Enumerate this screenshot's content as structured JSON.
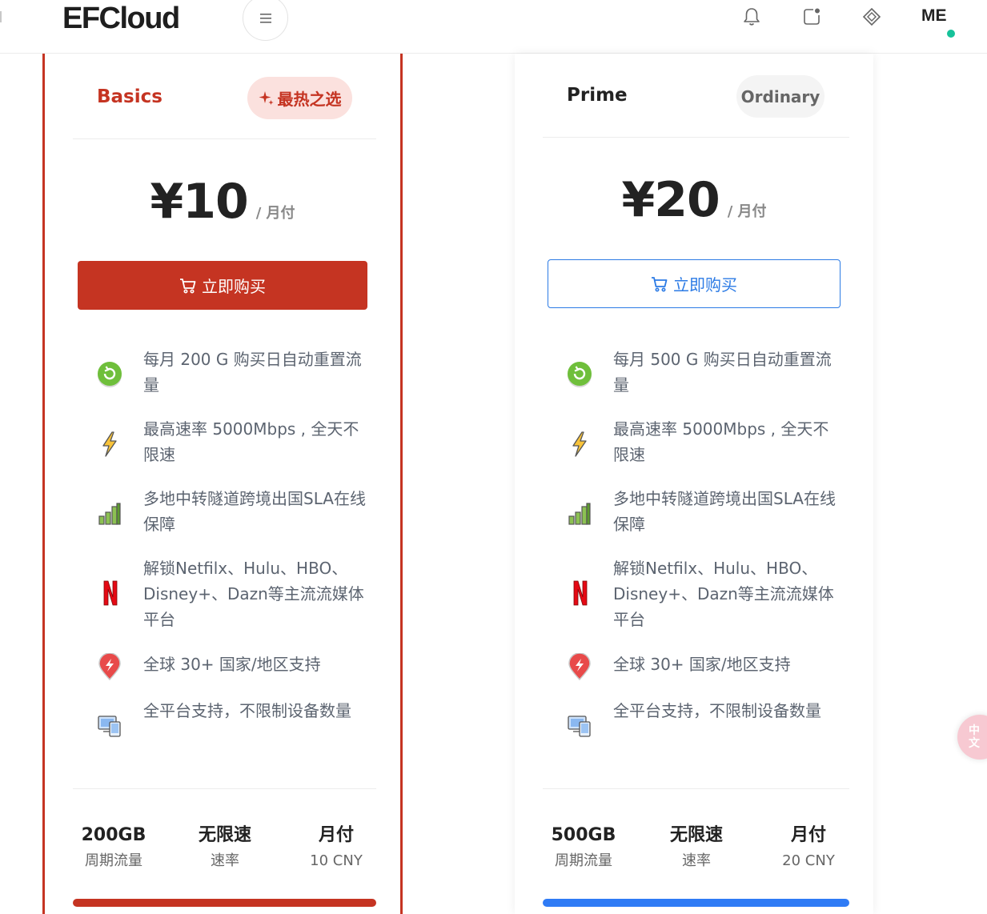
{
  "header": {
    "logo": "EFCloud",
    "user": "ME",
    "icons": [
      "menu-icon",
      "bell-icon",
      "notification-icon",
      "diamond-icon"
    ]
  },
  "colors": {
    "accent_red": "#c53422",
    "accent_blue": "#2f7bf5",
    "online": "#16c29a"
  },
  "plans": [
    {
      "name": "Basics",
      "badge": "最热之选",
      "price": "¥10",
      "period": "/ 月付",
      "buy_label": "立即购买",
      "features": [
        {
          "icon": "refresh-icon",
          "text": "每月 200 G 购买日自动重置流量"
        },
        {
          "icon": "lightning-icon",
          "text": "最高速率 5000Mbps , 全天不限速"
        },
        {
          "icon": "bar-chart-icon",
          "text": "多地中转隧道跨境出国SLA在线保障"
        },
        {
          "icon": "netflix-icon",
          "text": "解锁Netfilx、Hulu、HBO、Disney+、Dazn等主流流媒体平台"
        },
        {
          "icon": "location-pin-icon",
          "text": "全球 30+ 国家/地区支持"
        },
        {
          "icon": "devices-icon",
          "text": "全平台支持，不限制设备数量"
        }
      ],
      "stats": [
        {
          "value": "200GB",
          "label": "周期流量"
        },
        {
          "value": "无限速",
          "label": "速率"
        },
        {
          "value": "月付",
          "label": "10 CNY"
        }
      ]
    },
    {
      "name": "Prime",
      "badge": "Ordinary",
      "price": "¥20",
      "period": "/ 月付",
      "buy_label": "立即购买",
      "features": [
        {
          "icon": "refresh-icon",
          "text": "每月 500 G 购买日自动重置流量"
        },
        {
          "icon": "lightning-icon",
          "text": "最高速率 5000Mbps , 全天不限速"
        },
        {
          "icon": "bar-chart-icon",
          "text": "多地中转隧道跨境出国SLA在线保障"
        },
        {
          "icon": "netflix-icon",
          "text": "解锁Netfilx、Hulu、HBO、Disney+、Dazn等主流流媒体平台"
        },
        {
          "icon": "location-pin-icon",
          "text": "全球 30+ 国家/地区支持"
        },
        {
          "icon": "devices-icon",
          "text": "全平台支持，不限制设备数量"
        }
      ],
      "stats": [
        {
          "value": "500GB",
          "label": "周期流量"
        },
        {
          "value": "无限速",
          "label": "速率"
        },
        {
          "value": "月付",
          "label": "20 CNY"
        }
      ]
    }
  ],
  "language_button": "中\n文"
}
